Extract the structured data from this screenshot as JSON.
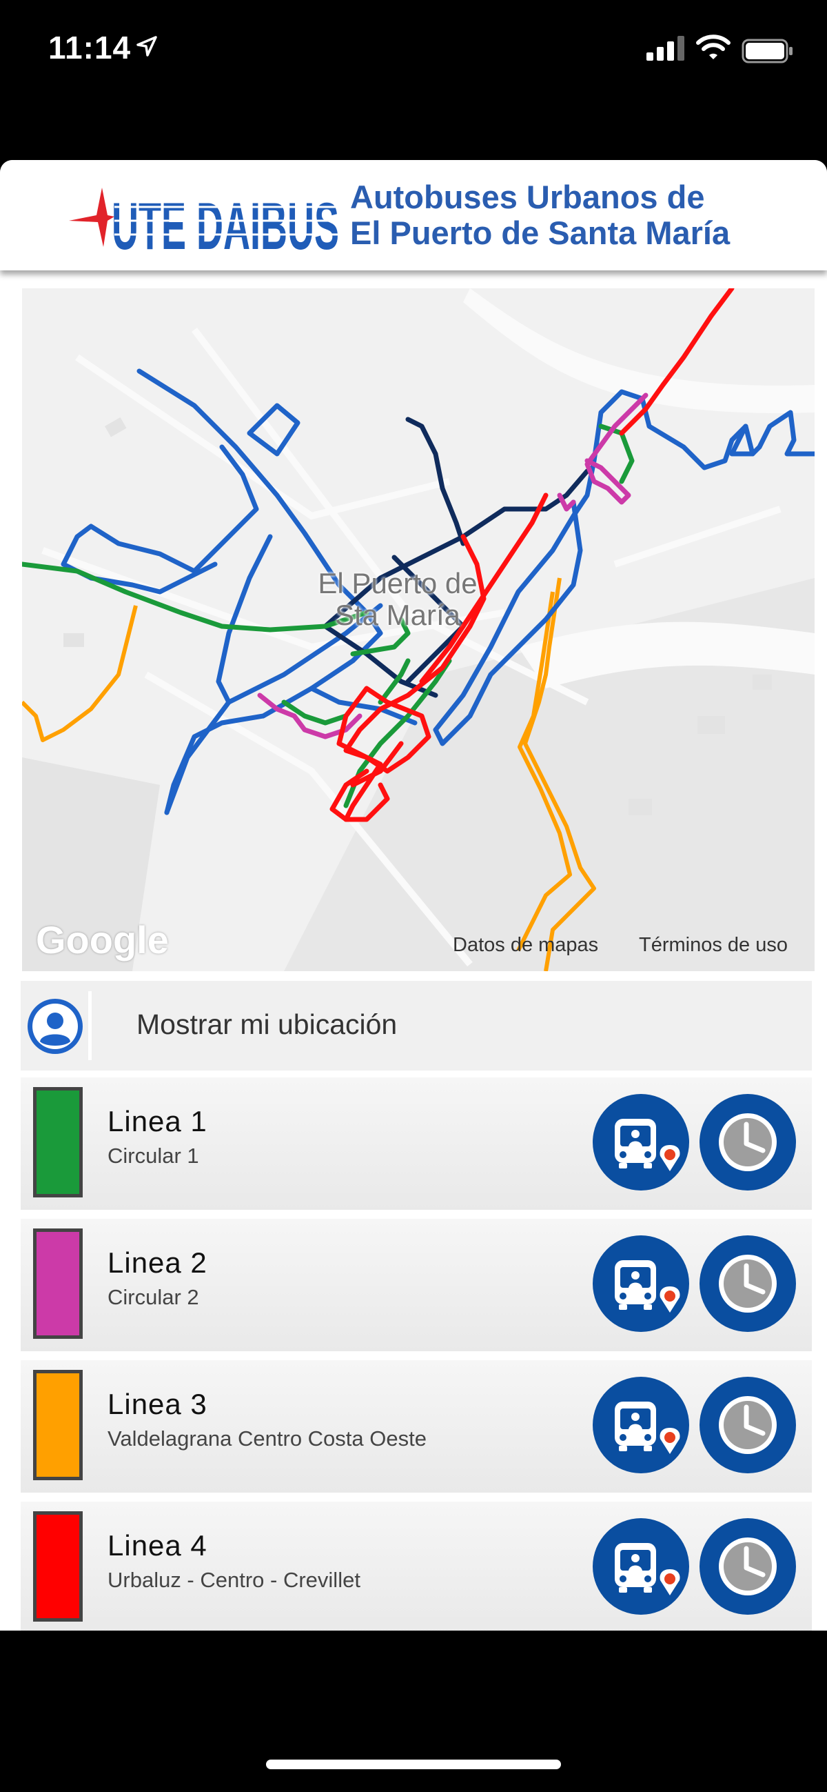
{
  "status_bar": {
    "time": "11:14"
  },
  "header": {
    "logo_text": "UTE DAIBUS",
    "brand_line1": "Autobuses Urbanos de",
    "brand_line2": "El Puerto de Santa María"
  },
  "map": {
    "label_line1": "El Puerto de",
    "label_line2": "Sta María",
    "google_logo": "Google",
    "map_data_link": "Datos de mapas",
    "terms_link": "Términos de uso"
  },
  "location": {
    "label": "Mostrar mi ubicación"
  },
  "lines": [
    {
      "title": "Linea 1",
      "subtitle": "Circular 1",
      "color": "#1a9a3a"
    },
    {
      "title": "Linea 2",
      "subtitle": "Circular 2",
      "color": "#cc3aa8"
    },
    {
      "title": "Linea 3",
      "subtitle": "Valdelagrana Centro Costa Oeste",
      "color": "#ffa000"
    },
    {
      "title": "Linea 4",
      "subtitle": "Urbaluz - Centro - Crevillet",
      "color": "#ff0000"
    }
  ],
  "colors": {
    "brand_blue": "#2a5db0",
    "button_blue": "#0a4ea0",
    "route_blue": "#1f63c8",
    "route_navy": "#0f2b5c"
  },
  "icons": {
    "bus_location": "bus-location-icon",
    "schedule": "clock-icon",
    "user": "user-avatar-icon"
  }
}
